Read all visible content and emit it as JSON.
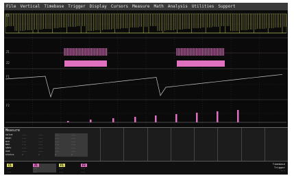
{
  "menu": {
    "items": [
      "File",
      "Vertical",
      "Timebase",
      "Trigger",
      "Display",
      "Cursors",
      "Measure",
      "Math",
      "Analysis",
      "Utilities",
      "Support"
    ]
  },
  "traces": {
    "C1": {
      "label": "C1",
      "color": "#d8d860"
    },
    "Z1": {
      "label": "Z1",
      "color": "#e070c0"
    },
    "Z2": {
      "label": "Z2",
      "color": "#e070c0"
    },
    "F1": {
      "label": "F1",
      "color": "#ffffff"
    },
    "F2": {
      "label": "F2",
      "color": "#ffffff"
    }
  },
  "measure": {
    "header": "Measure",
    "rows": [
      "value",
      "mean",
      "min",
      "max",
      "sdev",
      "num",
      "status"
    ],
    "column_values": [
      [
        "---",
        "---",
        "---",
        "---",
        "---",
        "---",
        "✓"
      ],
      [
        "---",
        "---",
        "---",
        "---",
        "---",
        "---",
        "✓"
      ],
      [
        "---",
        "---",
        "---",
        "---",
        "---",
        "---",
        "✓"
      ],
      [
        "---",
        "---",
        "---",
        "---",
        "---",
        "---",
        "✓"
      ]
    ]
  },
  "channels": [
    {
      "tag": "C1",
      "color": "#d8d860",
      "lines": [
        "---",
        "---",
        "---"
      ]
    },
    {
      "tag": "Z1",
      "color": "#e070c0",
      "lines": [
        "---",
        "---",
        "---"
      ]
    },
    {
      "tag": "F1",
      "color": "#d8d860",
      "lines": [
        "---",
        "---"
      ]
    },
    {
      "tag": "F2",
      "color": "#e070c0",
      "lines": [
        "---",
        "---"
      ]
    }
  ],
  "timebase": {
    "lines": [
      "Timebase",
      "Trigger",
      "---"
    ]
  },
  "colors": {
    "menu_bg": "#3a3a3a",
    "screen_bg": "#0a0a0a",
    "trace_yellow": "#d8d860",
    "trace_pink": "#e070c0",
    "grid": "#2f2f2f"
  }
}
